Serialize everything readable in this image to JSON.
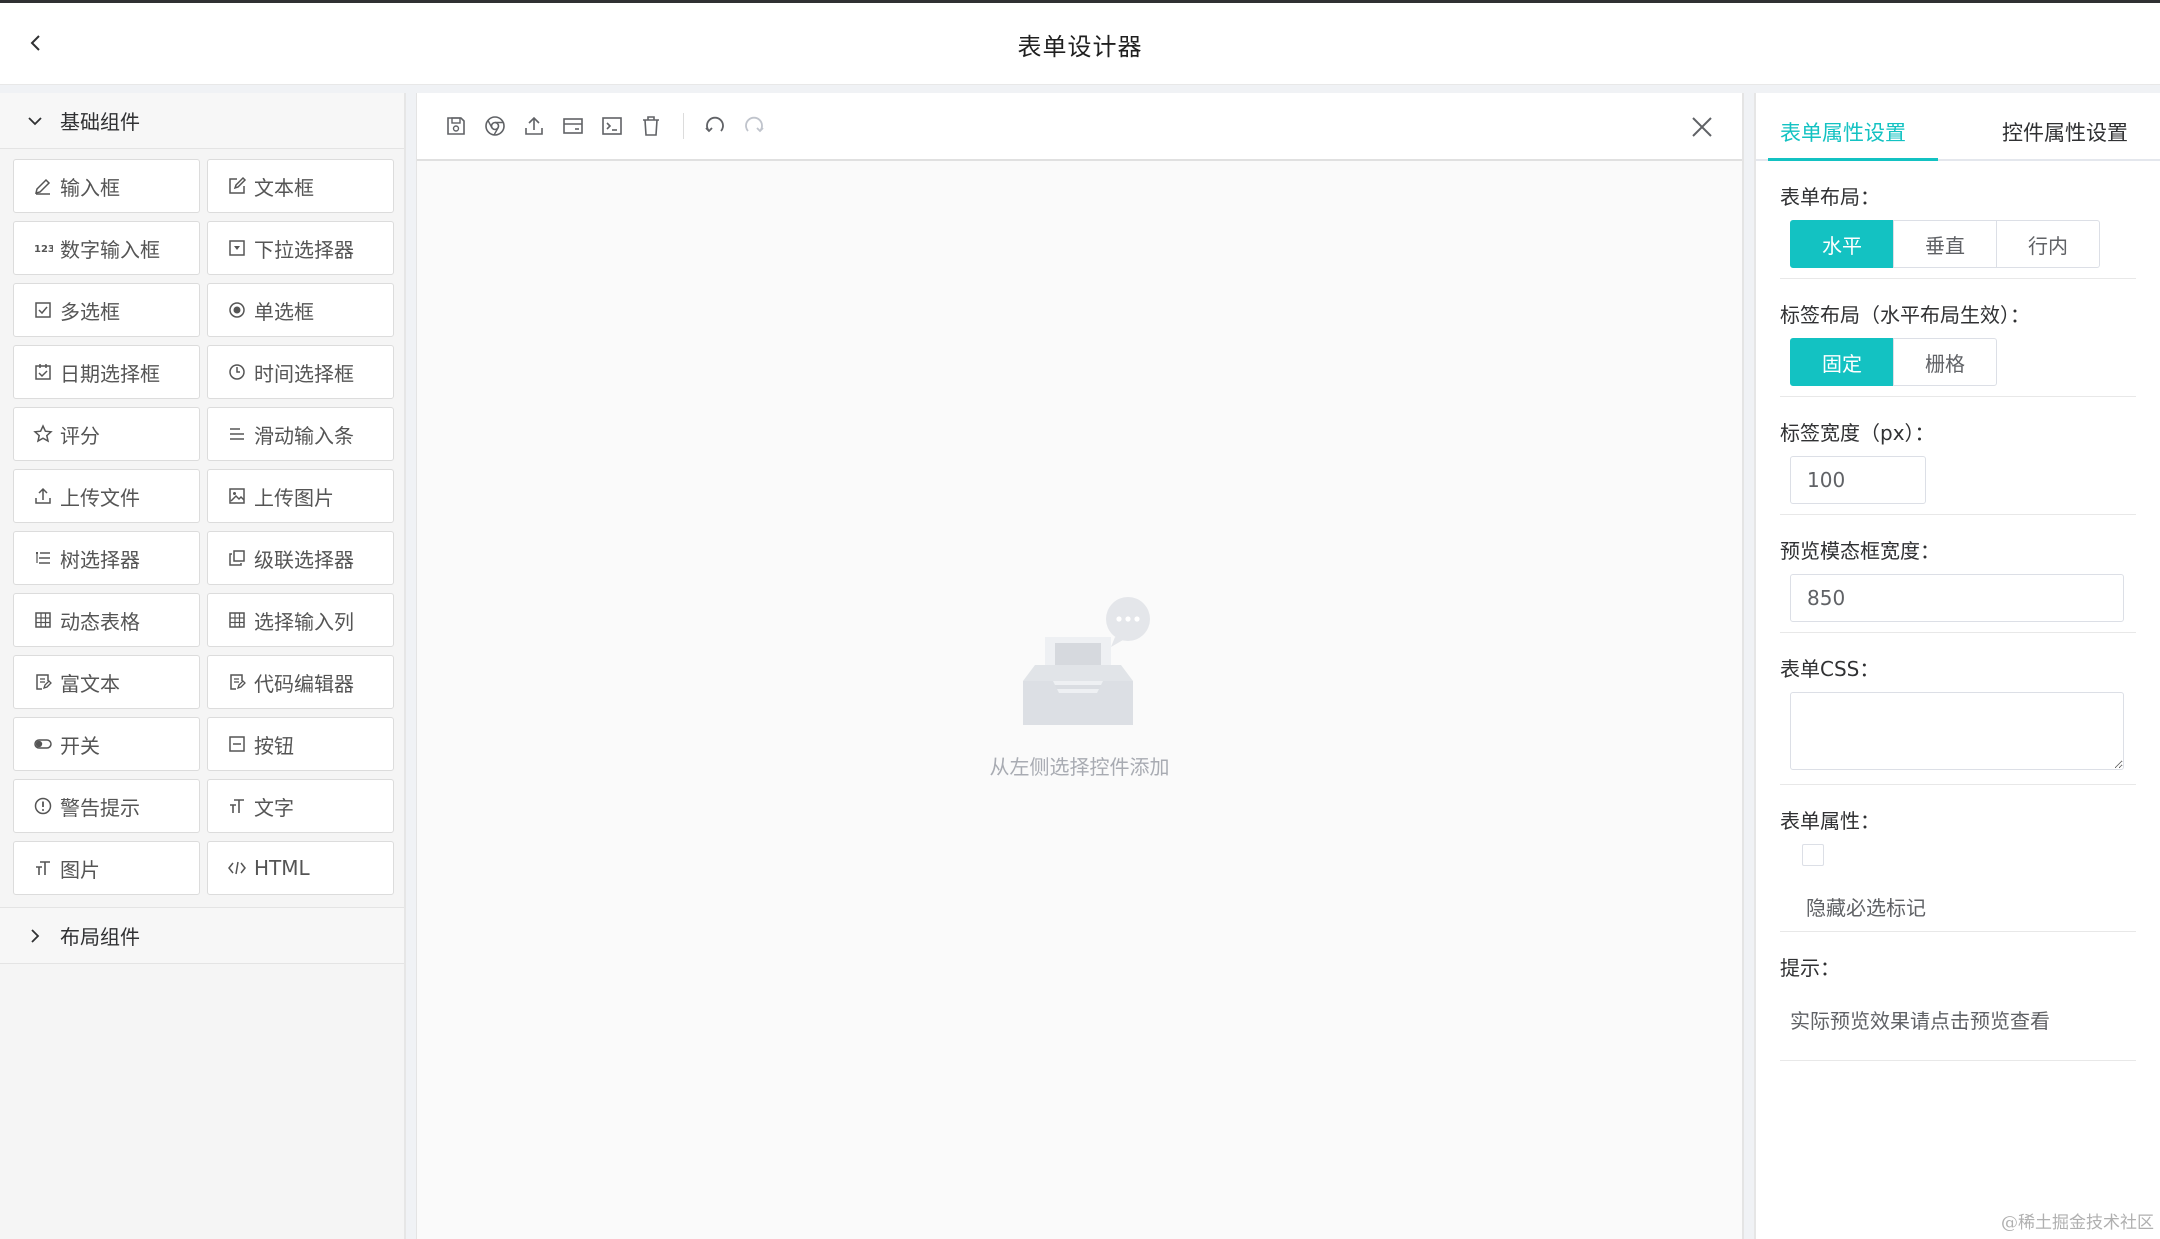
{
  "header": {
    "title": "表单设计器",
    "back_icon": "chevron-left-icon"
  },
  "left": {
    "basic_group": "基础组件",
    "layout_group": "布局组件",
    "components": [
      {
        "label": "输入框",
        "icon": "pencil-icon"
      },
      {
        "label": "文本框",
        "icon": "edit-square-icon"
      },
      {
        "label": "数字输入框",
        "icon": "number-123-icon"
      },
      {
        "label": "下拉选择器",
        "icon": "dropdown-box-icon"
      },
      {
        "label": "多选框",
        "icon": "checkbox-icon"
      },
      {
        "label": "单选框",
        "icon": "radio-icon"
      },
      {
        "label": "日期选择框",
        "icon": "calendar-check-icon"
      },
      {
        "label": "时间选择框",
        "icon": "clock-icon"
      },
      {
        "label": "评分",
        "icon": "star-icon"
      },
      {
        "label": "滑动输入条",
        "icon": "slider-lines-icon"
      },
      {
        "label": "上传文件",
        "icon": "upload-icon"
      },
      {
        "label": "上传图片",
        "icon": "image-icon"
      },
      {
        "label": "树选择器",
        "icon": "tree-list-icon"
      },
      {
        "label": "级联选择器",
        "icon": "cascade-icon"
      },
      {
        "label": "动态表格",
        "icon": "table-icon"
      },
      {
        "label": "选择输入列",
        "icon": "table-icon"
      },
      {
        "label": "富文本",
        "icon": "rich-text-icon"
      },
      {
        "label": "代码编辑器",
        "icon": "code-file-icon"
      },
      {
        "label": "开关",
        "icon": "switch-icon"
      },
      {
        "label": "按钮",
        "icon": "button-minus-icon"
      },
      {
        "label": "警告提示",
        "icon": "alert-circle-icon"
      },
      {
        "label": "文字",
        "icon": "text-type-icon"
      },
      {
        "label": "图片",
        "icon": "text-type-icon"
      },
      {
        "label": "HTML",
        "icon": "code-brackets-icon"
      }
    ]
  },
  "center": {
    "empty_text": "从左侧选择控件添加",
    "toolbar": [
      "save-icon",
      "preview-chrome-icon",
      "upload-icon",
      "card-icon",
      "terminal-icon",
      "trash-icon",
      "undo-icon",
      "redo-icon"
    ]
  },
  "right": {
    "tab_form": "表单属性设置",
    "tab_control": "控件属性设置",
    "form_layout_label": "表单布局：",
    "form_layout_options": [
      "水平",
      "垂直",
      "行内"
    ],
    "label_layout_label": "标签布局（水平布局生效）：",
    "label_layout_options": [
      "固定",
      "栅格"
    ],
    "label_width_label": "标签宽度（px）：",
    "label_width_value": "100",
    "preview_width_label": "预览模态框宽度：",
    "preview_width_value": "850",
    "form_css_label": "表单CSS：",
    "form_props_label": "表单属性：",
    "hide_required_label": "隐藏必选标记",
    "tip_label": "提示：",
    "tip_text": "实际预览效果请点击预览查看"
  },
  "watermark": "@稀土掘金技术社区",
  "colors": {
    "accent": "#13c2c2"
  }
}
